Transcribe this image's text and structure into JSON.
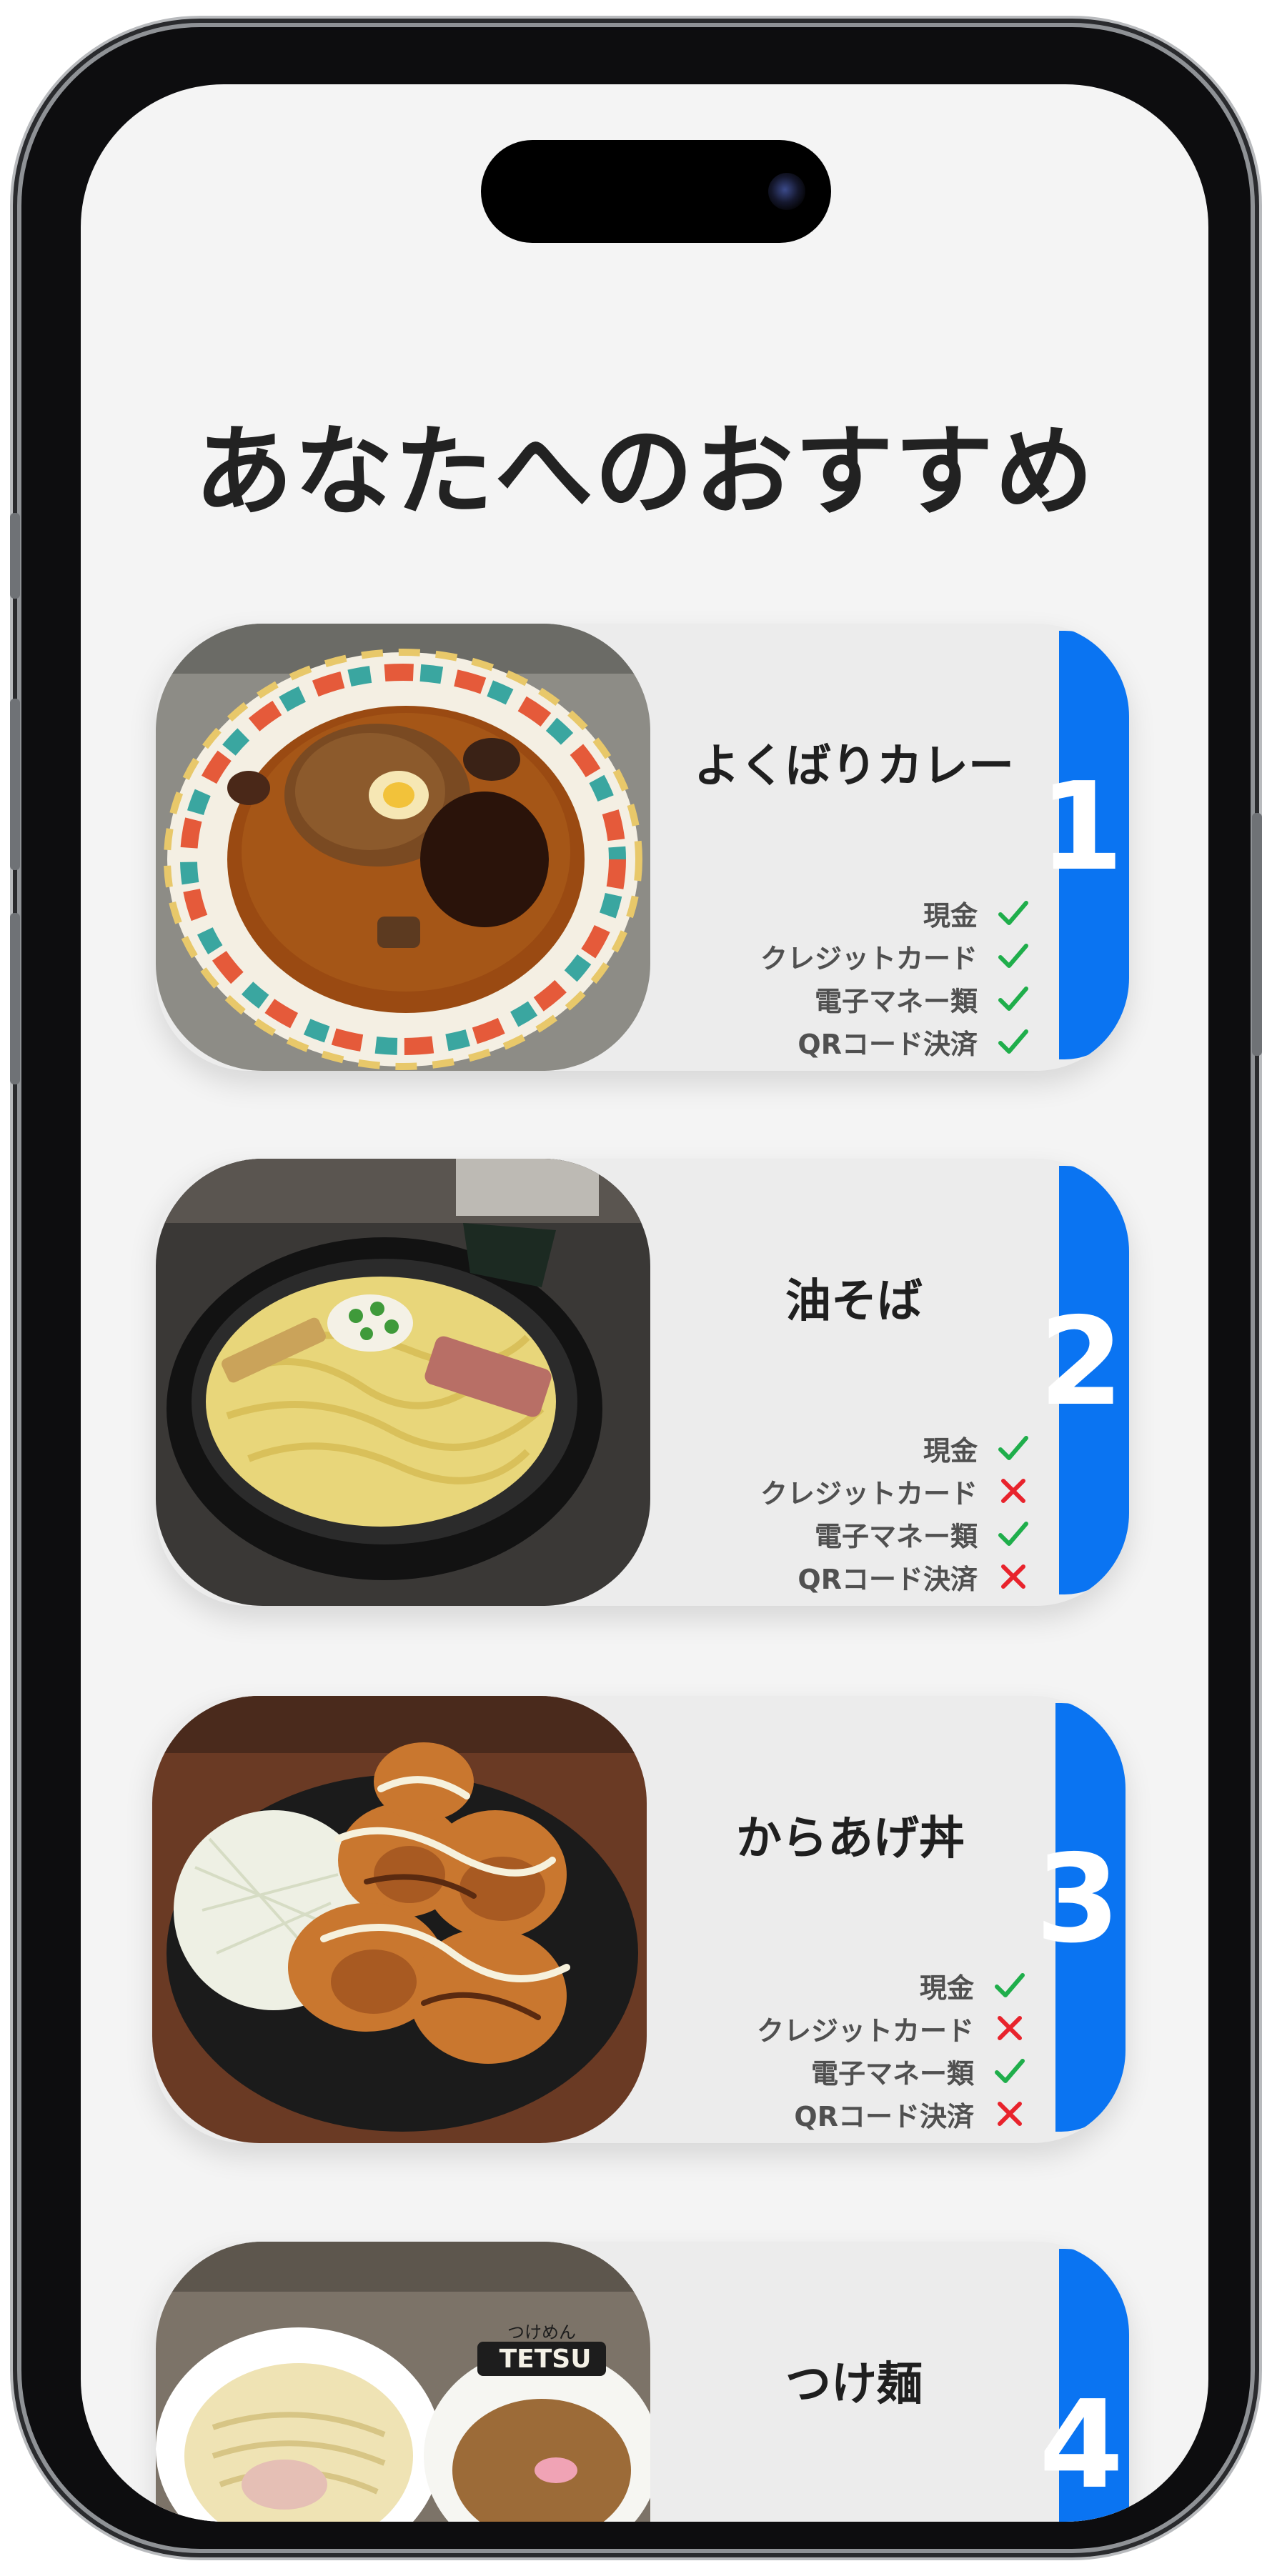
{
  "page": {
    "title": "あなたへのおすすめ"
  },
  "payment_labels": [
    "現金",
    "クレジットカード",
    "電子マネー類",
    "QRコード決済"
  ],
  "colors": {
    "accent": "#0a74f2",
    "ok": "#1fae4b",
    "ng": "#e8232c"
  },
  "recommendations": [
    {
      "rank": "1",
      "name": "よくばりカレー",
      "payments": [
        {
          "label": "現金",
          "ok": true
        },
        {
          "label": "クレジットカード",
          "ok": true
        },
        {
          "label": "電子マネー類",
          "ok": true
        },
        {
          "label": "QRコード決済",
          "ok": true
        }
      ]
    },
    {
      "rank": "2",
      "name": "油そば",
      "payments": [
        {
          "label": "現金",
          "ok": true
        },
        {
          "label": "クレジットカード",
          "ok": false
        },
        {
          "label": "電子マネー類",
          "ok": true
        },
        {
          "label": "QRコード決済",
          "ok": false
        }
      ]
    },
    {
      "rank": "3",
      "name": "からあげ丼",
      "payments": [
        {
          "label": "現金",
          "ok": true
        },
        {
          "label": "クレジットカード",
          "ok": false
        },
        {
          "label": "電子マネー類",
          "ok": true
        },
        {
          "label": "QRコード決済",
          "ok": false
        }
      ]
    },
    {
      "rank": "4",
      "name": "つけ麺",
      "payments": []
    }
  ],
  "photo_text": {
    "shop_logo_small": "つけめん",
    "shop_logo": "TETSU"
  }
}
